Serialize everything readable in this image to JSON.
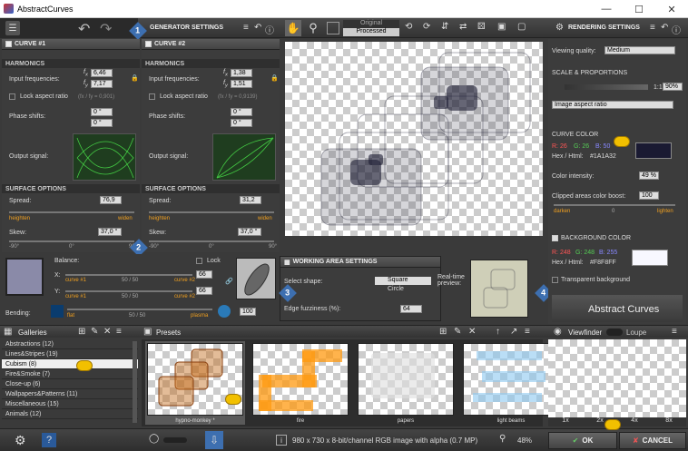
{
  "window": {
    "title": "AbstractCurves"
  },
  "toolbar": {
    "generator_settings": "GENERATOR SETTINGS",
    "original": "Original",
    "processed": "Processed",
    "rendering_settings": "RENDERING SETTINGS"
  },
  "curve1": {
    "title": "CURVE #1",
    "harmonics": "HARMONICS",
    "input_freq": "Input frequencies:",
    "fx": "6,46",
    "fy": "7,17",
    "lock": "Lock aspect ratio",
    "lock_note": "(fx / fy = 0,901)",
    "phase": "Phase shifts:",
    "px": "0 °",
    "py": "0 °",
    "output": "Output signal:",
    "surface": "SURFACE OPTIONS",
    "spread": "Spread:",
    "spread_val": "76,9",
    "heighten": "heighten",
    "widen": "widen",
    "skew": "Skew:",
    "skew_val": "37,0 °",
    "ticks": [
      "-90°",
      "0°",
      "90°"
    ]
  },
  "curve2": {
    "title": "CURVE #2",
    "harmonics": "HARMONICS",
    "input_freq": "Input frequencies:",
    "fx": "1,38",
    "fy": "1,51",
    "lock": "Lock aspect ratio",
    "lock_note": "(fx / fy = 0,9139)",
    "phase": "Phase shifts:",
    "px": "0 °",
    "py": "0 °",
    "output": "Output signal:",
    "surface": "SURFACE OPTIONS",
    "spread": "Spread:",
    "spread_val": "31,2",
    "heighten": "heighten",
    "widen": "widen",
    "skew": "Skew:",
    "skew_val": "37,0 °",
    "ticks": [
      "-90°",
      "0°",
      "90°"
    ]
  },
  "balance": {
    "label": "Balance:",
    "lock": "Lock",
    "x_label": "X:",
    "y_label": "Y:",
    "curve1": "curve #1",
    "curve2": "curve #2",
    "ratio": "50 / 50",
    "x_val": "66",
    "y_val": "66",
    "bending": "Bending:",
    "flat": "flat",
    "plasma": "plasma",
    "bend_ratio": "50 / 50",
    "bend_val": "100"
  },
  "working": {
    "title": "WORKING AREA SETTINGS",
    "select_shape": "Select shape:",
    "square": "Square",
    "circle": "Circle",
    "edge": "Edge fuzziness (%):",
    "edge_val": "64",
    "realtime": "Real-time preview:"
  },
  "rendering": {
    "viewing_quality": "Viewing quality:",
    "quality_val": "Medium",
    "scale": "SCALE & PROPORTIONS",
    "zoom_ratio": "1:1",
    "zoom_val": "90%",
    "aspect": "Image aspect ratio",
    "curve_color": "CURVE COLOR",
    "r": "R: 26",
    "g": "G: 26",
    "b": "B: 50",
    "hex_label": "Hex / Html:",
    "hex": "#1A1A32",
    "intensity": "Color intensity:",
    "intensity_val": "49 %",
    "clipped": "Clipped areas color boost:",
    "clipped_val": "100",
    "darken": "darken",
    "zero": "0",
    "lighten": "lighten",
    "bg_color": "BACKGROUND COLOR",
    "bg_r": "R: 248",
    "bg_g": "G: 248",
    "bg_b": "B: 255",
    "bg_hex": "#F8F8FF",
    "transparent": "Transparent background",
    "logo": "Abstract Curves"
  },
  "colors": {
    "curve": "#1A1A32",
    "background": "#F8F8FF"
  },
  "galleries": {
    "title": "Galleries",
    "items": [
      "Abstractions (12)",
      "Lines&Stripes (19)",
      "Cubism (8)",
      "Fire&Smoke (7)",
      "Close-up (6)",
      "Wallpapers&Patterns (11)",
      "Miscellaneous (15)",
      "Animals (12)"
    ]
  },
  "presets": {
    "title": "Presets",
    "items": [
      "hypno-monkey *",
      "fire",
      "papers",
      "light beams"
    ]
  },
  "viewfinder": {
    "tab1": "Viewfinder",
    "tab2": "Loupe",
    "zooms": [
      "1x",
      "2x",
      "4x",
      "8x"
    ]
  },
  "status": {
    "info": "980 x 730 x 8-bit/channel RGB image with alpha (0.7 MP)",
    "zoom": "48%",
    "ok": "OK",
    "cancel": "CANCEL"
  },
  "badges": [
    "1",
    "2",
    "3",
    "4"
  ]
}
